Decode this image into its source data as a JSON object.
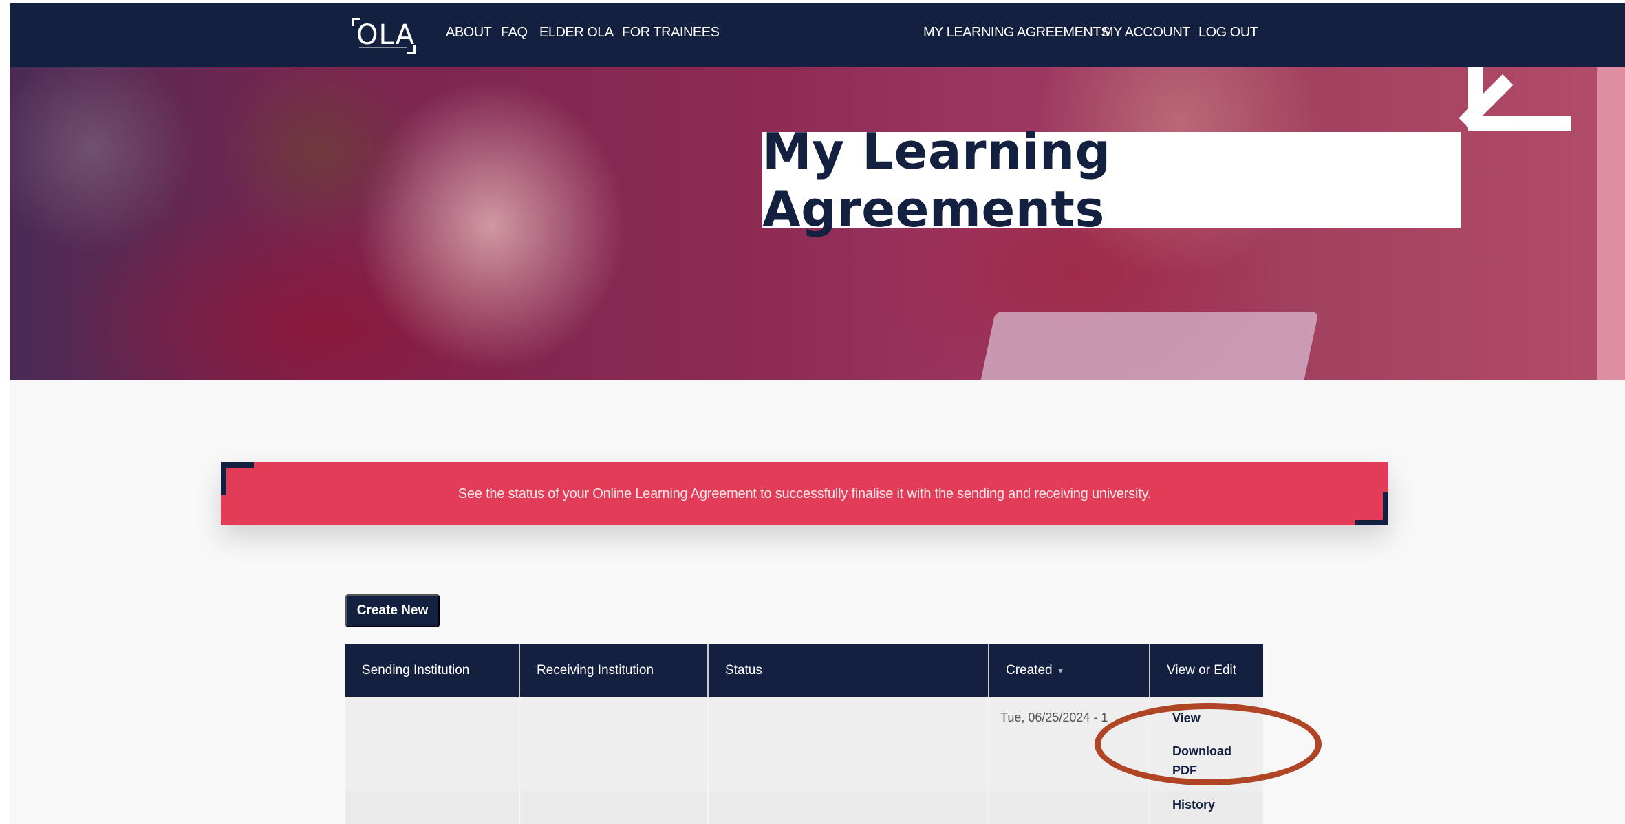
{
  "nav": {
    "logo_text": "OLA",
    "left_links": [
      "ABOUT",
      "FAQ",
      "ELDER OLA",
      "FOR TRAINEES"
    ],
    "right_links": [
      "MY LEARNING AGREEMENTS",
      "MY ACCOUNT",
      "LOG OUT"
    ]
  },
  "hero": {
    "title": "My Learning Agreements"
  },
  "banner": {
    "text": "See the status of your Online Learning Agreement to successfully finalise it with the sending and receiving university."
  },
  "actions": {
    "create_label": "Create New"
  },
  "table": {
    "headers": [
      "Sending Institution",
      "Receiving Institution",
      "Status",
      "Created",
      "View or Edit"
    ],
    "rows": [
      {
        "sending": "",
        "receiving": "",
        "status": "",
        "created": "Tue, 06/25/2024 - 1",
        "links": [
          "View",
          "Download",
          "PDF",
          "History"
        ]
      }
    ]
  },
  "colors": {
    "navy": "#13203f",
    "banner_red": "#e23c59",
    "highlight": "#b04525"
  }
}
